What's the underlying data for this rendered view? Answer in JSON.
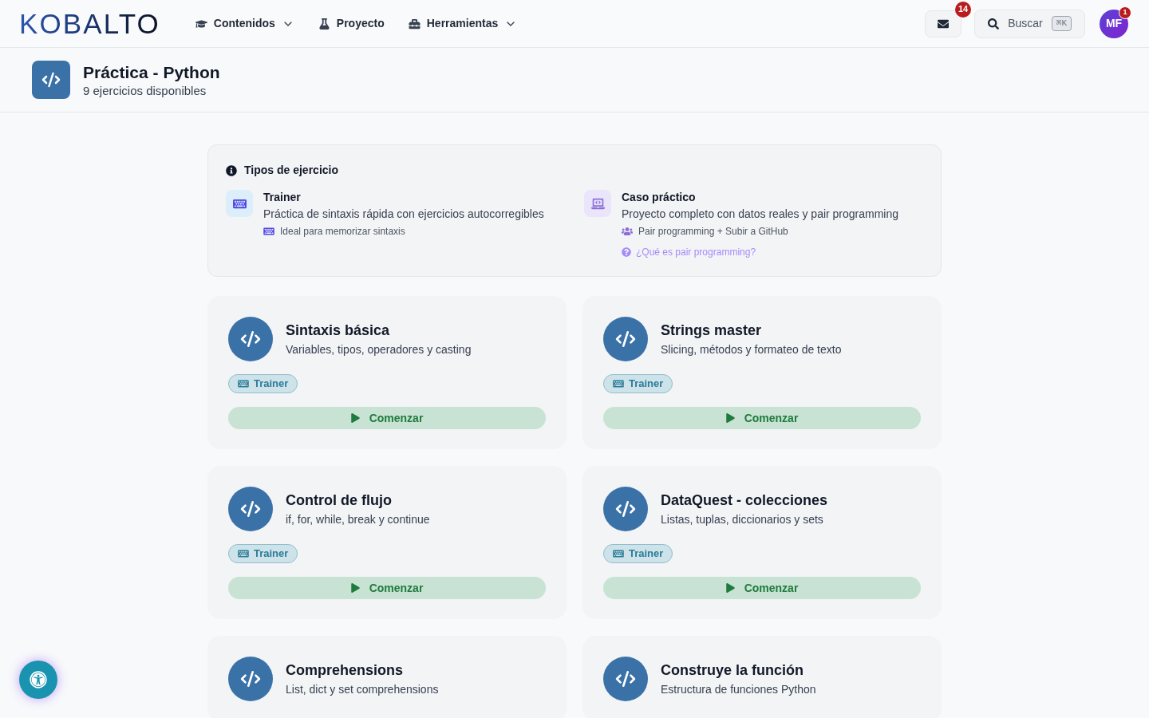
{
  "header": {
    "logo": "KOBALTO",
    "nav": [
      {
        "label": "Contenidos",
        "kind": "dropdown"
      },
      {
        "label": "Proyecto",
        "kind": "link"
      },
      {
        "label": "Herramientas",
        "kind": "dropdown"
      }
    ],
    "mail_badge": "14",
    "search": {
      "label": "Buscar",
      "shortcut": "⌘K"
    },
    "avatar": {
      "initials": "MF",
      "badge": "1"
    }
  },
  "page_header": {
    "title": "Práctica - Python",
    "subtitle": "9 ejercicios disponibles"
  },
  "info_box": {
    "title": "Tipos de ejercicio",
    "types": [
      {
        "kind": "trainer",
        "title": "Trainer",
        "description": "Práctica de sintaxis rápida con ejercicios autocorregibles",
        "note": "Ideal para memorizar sintaxis"
      },
      {
        "kind": "case",
        "title": "Caso práctico",
        "description": "Proyecto completo con datos reales y pair programming",
        "note": "Pair programming + Subir a GitHub",
        "link": "¿Qué es pair programming?"
      }
    ]
  },
  "exercises": [
    {
      "title": "Sintaxis básica",
      "description": "Variables, tipos, operadores y casting",
      "badge": "Trainer",
      "button": "Comenzar"
    },
    {
      "title": "Strings master",
      "description": "Slicing, métodos y formateo de texto",
      "badge": "Trainer",
      "button": "Comenzar"
    },
    {
      "title": "Control de flujo",
      "description": "if, for, while, break y continue",
      "badge": "Trainer",
      "button": "Comenzar"
    },
    {
      "title": "DataQuest - colecciones",
      "description": "Listas, tuplas, diccionarios y sets",
      "badge": "Trainer",
      "button": "Comenzar"
    },
    {
      "title": "Comprehensions",
      "description": "List, dict y set comprehensions"
    },
    {
      "title": "Construye la función",
      "description": "Estructura de funciones Python"
    }
  ]
}
